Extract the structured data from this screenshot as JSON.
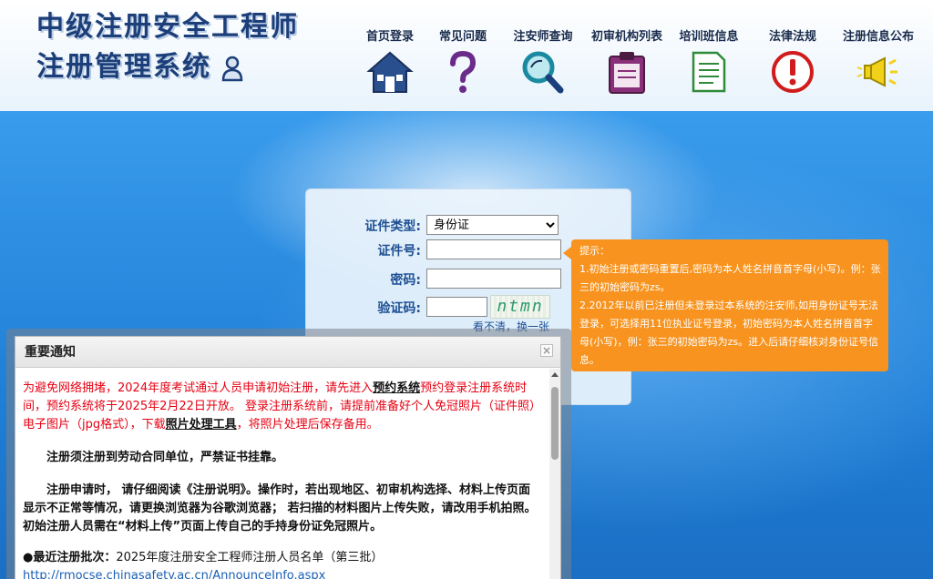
{
  "header": {
    "logo_line1": "中级注册安全工程师",
    "logo_line2": "注册管理系统",
    "nav": [
      {
        "label": "首页登录",
        "icon": "home-icon"
      },
      {
        "label": "常见问题",
        "icon": "question-icon"
      },
      {
        "label": "注安师查询",
        "icon": "magnifier-icon"
      },
      {
        "label": "初审机构列表",
        "icon": "clipboard-icon"
      },
      {
        "label": "培训班信息",
        "icon": "document-icon"
      },
      {
        "label": "法律法规",
        "icon": "alert-icon"
      },
      {
        "label": "注册信息公布",
        "icon": "megaphone-icon"
      }
    ]
  },
  "login": {
    "id_type_label": "证件类型:",
    "id_type_value": "身份证",
    "id_number_label": "证件号:",
    "password_label": "密码:",
    "captcha_label": "验证码:",
    "captcha_text": "ntmn",
    "refresh_text": "看不清，换一张"
  },
  "tip": {
    "title": "提示：",
    "line1": "1.初始注册或密码重置后,密码为本人姓名拼音首字母(小写)。例：张三的初始密码为zs。",
    "line2": "2.2012年以前已注册但未登录过本系统的注安师,如用身份证号无法登录，可选择用11位执业证号登录，初始密码为本人姓名拼音首字母(小写)，例：张三的初始密码为zs。进入后请仔细核对身份证号信息。"
  },
  "notice": {
    "title": "重要通知",
    "close": "×",
    "red_1": "为避免网络拥堵，2024年度考试通过人员申请初始注册，请先进入",
    "red_link1": "预约系统",
    "red_2": "预约登录注册系统时间，预约系统将于2025年2月22日开放。 登录注册系统前，请提前准备好个人免冠照片（证件照）电子图片（jpg格式），下载",
    "red_link2": "照片处理工具",
    "red_3": "，将照片处理后保存备用。",
    "para1": "注册须注册到劳动合同单位，严禁证书挂靠。",
    "para2": "注册申请时， 请仔细阅读《注册说明》。操作时，若出现地区、初审机构选择、材料上传页面显示不正常等情况，请更换浏览器为谷歌浏览器； 若扫描的材料图片上传失败，请改用手机拍照。初始注册人员需在“材料上传”页面上传自己的手持身份证免冠照片。",
    "batch_label": "●最近注册批次：",
    "batch_value": "2025年度注册安全工程师注册人员名单（第三批）",
    "batch_url": "http://rmocse.chinasafety.ac.cn/AnnounceInfo.aspx"
  }
}
